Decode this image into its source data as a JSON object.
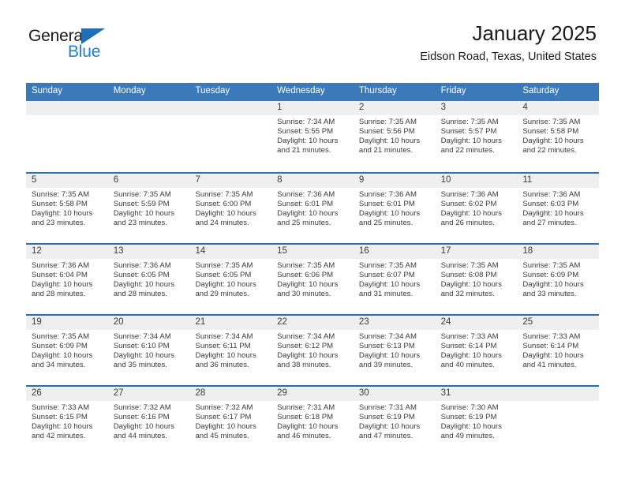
{
  "brand": {
    "name_part1": "General",
    "name_part2": "Blue",
    "triangle_icon": "triangle-icon",
    "accent_dark": "#1f6fb5",
    "accent_light": "#1f7fd4"
  },
  "header": {
    "title": "January 2025",
    "subtitle": "Eidson Road, Texas, United States"
  },
  "theme": {
    "header_blue": "#3b79b8",
    "row_divider_blue": "#2e6da8",
    "daynum_band": "#efefef",
    "text": "#3a3a3a"
  },
  "weekdays": [
    {
      "label": "Sunday"
    },
    {
      "label": "Monday"
    },
    {
      "label": "Tuesday"
    },
    {
      "label": "Wednesday"
    },
    {
      "label": "Thursday"
    },
    {
      "label": "Friday"
    },
    {
      "label": "Saturday"
    }
  ],
  "weeks": [
    [
      {
        "day": "",
        "empty": true,
        "lines": []
      },
      {
        "day": "",
        "empty": true,
        "lines": []
      },
      {
        "day": "",
        "empty": true,
        "lines": []
      },
      {
        "day": "1",
        "empty": false,
        "lines": [
          "Sunrise: 7:34 AM",
          "Sunset: 5:55 PM",
          "Daylight: 10 hours",
          "and 21 minutes."
        ]
      },
      {
        "day": "2",
        "empty": false,
        "lines": [
          "Sunrise: 7:35 AM",
          "Sunset: 5:56 PM",
          "Daylight: 10 hours",
          "and 21 minutes."
        ]
      },
      {
        "day": "3",
        "empty": false,
        "lines": [
          "Sunrise: 7:35 AM",
          "Sunset: 5:57 PM",
          "Daylight: 10 hours",
          "and 22 minutes."
        ]
      },
      {
        "day": "4",
        "empty": false,
        "lines": [
          "Sunrise: 7:35 AM",
          "Sunset: 5:58 PM",
          "Daylight: 10 hours",
          "and 22 minutes."
        ]
      }
    ],
    [
      {
        "day": "5",
        "empty": false,
        "lines": [
          "Sunrise: 7:35 AM",
          "Sunset: 5:58 PM",
          "Daylight: 10 hours",
          "and 23 minutes."
        ]
      },
      {
        "day": "6",
        "empty": false,
        "lines": [
          "Sunrise: 7:35 AM",
          "Sunset: 5:59 PM",
          "Daylight: 10 hours",
          "and 23 minutes."
        ]
      },
      {
        "day": "7",
        "empty": false,
        "lines": [
          "Sunrise: 7:35 AM",
          "Sunset: 6:00 PM",
          "Daylight: 10 hours",
          "and 24 minutes."
        ]
      },
      {
        "day": "8",
        "empty": false,
        "lines": [
          "Sunrise: 7:36 AM",
          "Sunset: 6:01 PM",
          "Daylight: 10 hours",
          "and 25 minutes."
        ]
      },
      {
        "day": "9",
        "empty": false,
        "lines": [
          "Sunrise: 7:36 AM",
          "Sunset: 6:01 PM",
          "Daylight: 10 hours",
          "and 25 minutes."
        ]
      },
      {
        "day": "10",
        "empty": false,
        "lines": [
          "Sunrise: 7:36 AM",
          "Sunset: 6:02 PM",
          "Daylight: 10 hours",
          "and 26 minutes."
        ]
      },
      {
        "day": "11",
        "empty": false,
        "lines": [
          "Sunrise: 7:36 AM",
          "Sunset: 6:03 PM",
          "Daylight: 10 hours",
          "and 27 minutes."
        ]
      }
    ],
    [
      {
        "day": "12",
        "empty": false,
        "lines": [
          "Sunrise: 7:36 AM",
          "Sunset: 6:04 PM",
          "Daylight: 10 hours",
          "and 28 minutes."
        ]
      },
      {
        "day": "13",
        "empty": false,
        "lines": [
          "Sunrise: 7:36 AM",
          "Sunset: 6:05 PM",
          "Daylight: 10 hours",
          "and 28 minutes."
        ]
      },
      {
        "day": "14",
        "empty": false,
        "lines": [
          "Sunrise: 7:35 AM",
          "Sunset: 6:05 PM",
          "Daylight: 10 hours",
          "and 29 minutes."
        ]
      },
      {
        "day": "15",
        "empty": false,
        "lines": [
          "Sunrise: 7:35 AM",
          "Sunset: 6:06 PM",
          "Daylight: 10 hours",
          "and 30 minutes."
        ]
      },
      {
        "day": "16",
        "empty": false,
        "lines": [
          "Sunrise: 7:35 AM",
          "Sunset: 6:07 PM",
          "Daylight: 10 hours",
          "and 31 minutes."
        ]
      },
      {
        "day": "17",
        "empty": false,
        "lines": [
          "Sunrise: 7:35 AM",
          "Sunset: 6:08 PM",
          "Daylight: 10 hours",
          "and 32 minutes."
        ]
      },
      {
        "day": "18",
        "empty": false,
        "lines": [
          "Sunrise: 7:35 AM",
          "Sunset: 6:09 PM",
          "Daylight: 10 hours",
          "and 33 minutes."
        ]
      }
    ],
    [
      {
        "day": "19",
        "empty": false,
        "lines": [
          "Sunrise: 7:35 AM",
          "Sunset: 6:09 PM",
          "Daylight: 10 hours",
          "and 34 minutes."
        ]
      },
      {
        "day": "20",
        "empty": false,
        "lines": [
          "Sunrise: 7:34 AM",
          "Sunset: 6:10 PM",
          "Daylight: 10 hours",
          "and 35 minutes."
        ]
      },
      {
        "day": "21",
        "empty": false,
        "lines": [
          "Sunrise: 7:34 AM",
          "Sunset: 6:11 PM",
          "Daylight: 10 hours",
          "and 36 minutes."
        ]
      },
      {
        "day": "22",
        "empty": false,
        "lines": [
          "Sunrise: 7:34 AM",
          "Sunset: 6:12 PM",
          "Daylight: 10 hours",
          "and 38 minutes."
        ]
      },
      {
        "day": "23",
        "empty": false,
        "lines": [
          "Sunrise: 7:34 AM",
          "Sunset: 6:13 PM",
          "Daylight: 10 hours",
          "and 39 minutes."
        ]
      },
      {
        "day": "24",
        "empty": false,
        "lines": [
          "Sunrise: 7:33 AM",
          "Sunset: 6:14 PM",
          "Daylight: 10 hours",
          "and 40 minutes."
        ]
      },
      {
        "day": "25",
        "empty": false,
        "lines": [
          "Sunrise: 7:33 AM",
          "Sunset: 6:14 PM",
          "Daylight: 10 hours",
          "and 41 minutes."
        ]
      }
    ],
    [
      {
        "day": "26",
        "empty": false,
        "lines": [
          "Sunrise: 7:33 AM",
          "Sunset: 6:15 PM",
          "Daylight: 10 hours",
          "and 42 minutes."
        ]
      },
      {
        "day": "27",
        "empty": false,
        "lines": [
          "Sunrise: 7:32 AM",
          "Sunset: 6:16 PM",
          "Daylight: 10 hours",
          "and 44 minutes."
        ]
      },
      {
        "day": "28",
        "empty": false,
        "lines": [
          "Sunrise: 7:32 AM",
          "Sunset: 6:17 PM",
          "Daylight: 10 hours",
          "and 45 minutes."
        ]
      },
      {
        "day": "29",
        "empty": false,
        "lines": [
          "Sunrise: 7:31 AM",
          "Sunset: 6:18 PM",
          "Daylight: 10 hours",
          "and 46 minutes."
        ]
      },
      {
        "day": "30",
        "empty": false,
        "lines": [
          "Sunrise: 7:31 AM",
          "Sunset: 6:19 PM",
          "Daylight: 10 hours",
          "and 47 minutes."
        ]
      },
      {
        "day": "31",
        "empty": false,
        "lines": [
          "Sunrise: 7:30 AM",
          "Sunset: 6:19 PM",
          "Daylight: 10 hours",
          "and 49 minutes."
        ]
      },
      {
        "day": "",
        "empty": true,
        "lines": []
      }
    ]
  ]
}
